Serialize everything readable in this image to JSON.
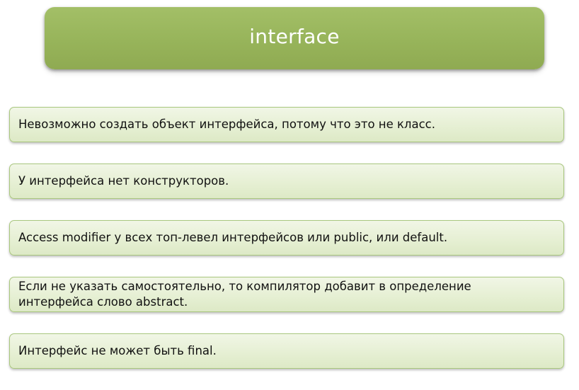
{
  "slide": {
    "title": "interface",
    "items": [
      "Невозможно создать объект интерфейса, потому что это не класс.",
      "У интерфейса нет конструкторов.",
      "Access modifier у всех топ-левел интерфейсов или public, или default.",
      "Если не указать самостоятельно, то компилятор добавит в определение интерфейса слово abstract.",
      "Интерфейс не может быть final."
    ]
  },
  "colors": {
    "title_fill": "#97b45a",
    "item_fill": "#e5efd2",
    "item_border": "#a9c77e"
  }
}
